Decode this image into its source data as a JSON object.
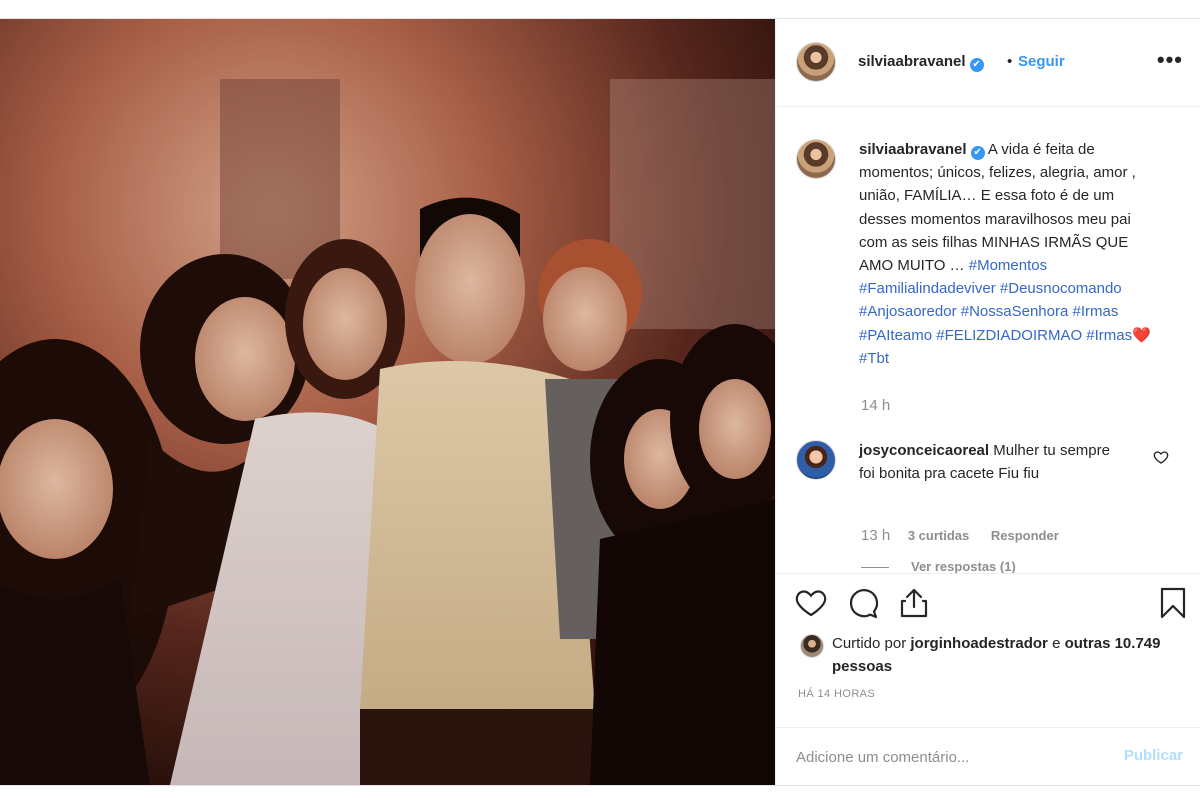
{
  "post": {
    "username": "silviaabravanel",
    "verified_mark": "✔",
    "separator": "•",
    "follow_label": "Seguir",
    "more_label": "•••",
    "caption_text": "A vida é feita de momentos; únicos, felizes, alegria, amor , união, FAMÍLIA… E essa foto é de um desses momentos maravilhosos meu pai com as seis filhas MINHAS IRMÃS QUE AMO MUITO …",
    "hashtags_1": "#Momentos #Familialindadeviver #Deusnocomando #Anjosaoredor #NossaSenhora #Irmas #PAIteamo #FELIZDIADOIRMAO #Irmas",
    "heart_emoji": "❤️",
    "hashtags_2": "#Tbt",
    "caption_time": "14 h"
  },
  "comment": {
    "username": "josyconceicaoreal",
    "text": "Mulher tu sempre foi bonita pra cacete Fiu fiu",
    "time": "13 h",
    "likes": "3 curtidas",
    "reply_label": "Responder",
    "view_replies": "Ver respostas (1)"
  },
  "likes": {
    "prefix": "Curtido por",
    "user": "jorginhoadestrador",
    "connector": "e",
    "others": "outras 10.749 pessoas"
  },
  "timestamp": "HÁ 14 HORAS",
  "add_comment": {
    "placeholder": "Adicione um comentário...",
    "publish_label": "Publicar"
  },
  "icons": {
    "like": "heart-outline-icon",
    "comment": "speech-bubble-icon",
    "share": "share-icon",
    "save": "bookmark-icon",
    "comment_like": "small-heart-icon"
  },
  "colors": {
    "link_blue": "#3897f0",
    "hashtag_blue": "#3568c8",
    "muted_gray": "#8e8e8e",
    "publish_disabled": "#b2dffc"
  }
}
